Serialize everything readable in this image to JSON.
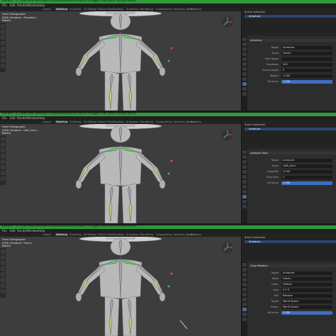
{
  "app": {
    "title": "Blender* [C:\\Users\\Michelle\\Sketchfab\\Downloads\\Armature 3 Rigged (SK) point sample.blend]"
  },
  "menu": [
    "File",
    "Edit",
    "Render",
    "Window",
    "Help"
  ],
  "workspaces": [
    "Layout",
    "Modeling",
    "Sculpting",
    "UV Editing",
    "Texture Paint",
    "Shading",
    "Animation",
    "Rendering",
    "Compositing",
    "Geometry Nodes",
    "Scripting"
  ],
  "active_workspace": "Modeling",
  "panels": [
    {
      "viewport_info": [
        "Front Orthographic",
        "(550) Armature : Shoulder.L",
        "Meters"
      ],
      "outliner": [
        "Scene Collection",
        "Armature"
      ],
      "properties": {
        "section": "Armature",
        "fields": [
          {
            "label": "Target",
            "value": "Armature"
          },
          {
            "label": "Bone",
            "value": "Hand.L"
          },
          {
            "label": "Pole Target",
            "value": ""
          },
          {
            "label": "Iterations",
            "value": "500"
          },
          {
            "label": "Chain Length",
            "value": "0"
          },
          {
            "label": "Weight",
            "value": "1.000"
          },
          {
            "label": "Influence",
            "value": "1.000"
          }
        ]
      }
    },
    {
      "viewport_info": [
        "Front Orthographic",
        "(550) Armature : UAR_Arm.L",
        "Meters"
      ],
      "outliner": [
        "Scene Collection",
        "Armature"
      ],
      "properties": {
        "section": "Damped Track",
        "fields": [
          {
            "label": "Target",
            "value": "Armature"
          },
          {
            "label": "Bone",
            "value": "UAR_Arm.L"
          },
          {
            "label": "Head/Tail",
            "value": "0.000"
          },
          {
            "label": "Track Axis",
            "value": "Y"
          },
          {
            "label": "Influence",
            "value": "1.000"
          }
        ]
      }
    },
    {
      "viewport_info": [
        "Front Orthographic",
        "(550) Armature : Hand.L",
        "Meters"
      ],
      "outliner": [
        "Scene Collection",
        "Armature"
      ],
      "properties": {
        "section": "Copy Rotation",
        "fields": [
          {
            "label": "Target",
            "value": "Armature"
          },
          {
            "label": "Bone",
            "value": "Hand.L"
          },
          {
            "label": "Order",
            "value": "Default"
          },
          {
            "label": "Axis",
            "value": "X Y Z"
          },
          {
            "label": "Mix",
            "value": "Replace"
          },
          {
            "label": "Target",
            "value": "World Space"
          },
          {
            "label": "Owner",
            "value": "World Space"
          },
          {
            "label": "Influence",
            "value": "1.000"
          }
        ]
      }
    }
  ],
  "colors": {
    "titlebar": "#2f9a3a",
    "viewport": "#3d3d3d",
    "body": "#b9b9b9",
    "bone": "#a3a3a3",
    "active_bone": "#66c66a",
    "ik_bone": "#c9c47a"
  }
}
